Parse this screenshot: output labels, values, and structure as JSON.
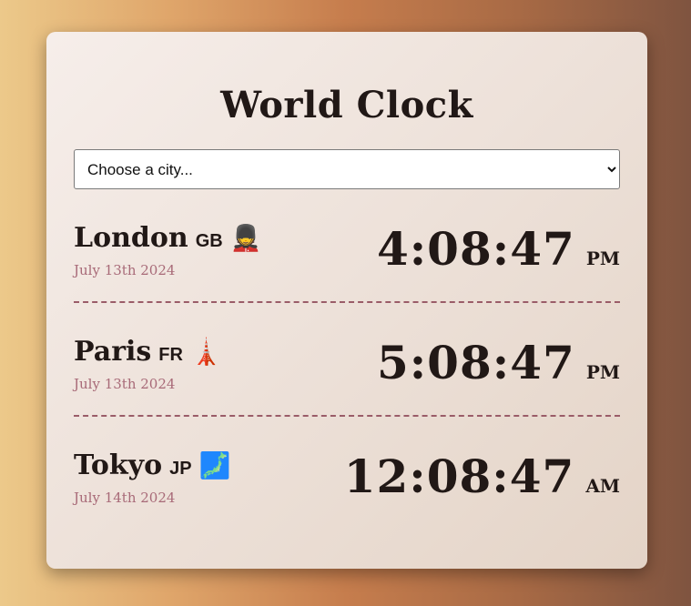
{
  "title": "World Clock",
  "select": {
    "placeholder": "Choose a city..."
  },
  "cities": [
    {
      "name": "London",
      "code": "GB",
      "emoji": "💂",
      "emoji_name": "guard-icon",
      "date": "July 13th 2024",
      "time": "4:08:47",
      "ampm": "PM"
    },
    {
      "name": "Paris",
      "code": "FR",
      "emoji": "🗼",
      "emoji_name": "tower-icon",
      "date": "July 13th 2024",
      "time": "5:08:47",
      "ampm": "PM"
    },
    {
      "name": "Tokyo",
      "code": "JP",
      "emoji": "🗾",
      "emoji_name": "japan-map-icon",
      "date": "July 14th 2024",
      "time": "12:08:47",
      "ampm": "AM"
    }
  ]
}
